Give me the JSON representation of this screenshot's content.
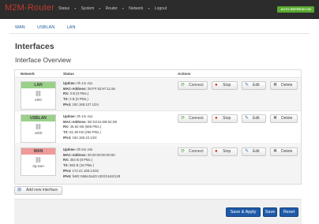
{
  "navbar": {
    "brand": "M2M-Router",
    "menu": [
      "Status",
      "System",
      "Router",
      "Network",
      "Logout"
    ],
    "auto_refresh": "AUTO REFRESH ON"
  },
  "subtabs": [
    "WAN",
    "USBLAN",
    "LAN"
  ],
  "page": {
    "title": "Interfaces",
    "subtitle": "Interface Overview"
  },
  "table": {
    "headers": {
      "network": "Network",
      "status": "Status",
      "actions": "Actions"
    },
    "rows": [
      {
        "name": "LAN",
        "color": "#9ad18a",
        "device": "eth0",
        "uptime_label": "Uptime:",
        "uptime": "0h 1m 41s",
        "mac_label": "MAC-Address:",
        "mac": "06:FF:63:97:11:66",
        "rx_label": "RX:",
        "rx": "0 B (0 Pkts.)",
        "tx_label": "TX:",
        "tx": "0 B (0 Pkts.)",
        "ipv4_label": "IPv4:",
        "ipv4": "192.168.127.1/24"
      },
      {
        "name": "USBLAN",
        "color": "#9ad18a",
        "device": "usb0",
        "uptime_label": "Uptime:",
        "uptime": "0h 1m 41s",
        "mac_label": "MAC-Address:",
        "mac": "5E:D2:51:B8:52:D5",
        "rx_label": "RX:",
        "rx": "45.84 KB (686 Pkts.)",
        "tx_label": "TX:",
        "tx": "81.38 KB (256 Pkts.)",
        "ipv4_label": "IPv4:",
        "ipv4": "192.168.10.1/24"
      },
      {
        "name": "WAN",
        "color": "#ef9a9a",
        "device": "3g-wan",
        "uptime_label": "Uptime:",
        "uptime": "0h 0m 44s",
        "mac_label": "MAC-Address:",
        "mac": "00:00:00:00:00:00",
        "rx_label": "RX:",
        "rx": "354 B (8 Pkts.)",
        "tx_label": "TX:",
        "tx": "862 B (16 Pkts.)",
        "ipv4_label": "IPv4:",
        "ipv4": "172.21.168.14/32",
        "ipv6_label": "IPv6:",
        "ipv6": "fe80::558a:5a23:c303:b163/128"
      }
    ],
    "actions": {
      "connect": "Connect",
      "stop": "Stop",
      "edit": "Edit",
      "delete": "Delete"
    }
  },
  "add_button": "Add new interface",
  "footer": {
    "save_apply": "Save & Apply",
    "save": "Save",
    "reset": "Reset"
  },
  "icons": {
    "connect": "refresh-icon",
    "stop": "stop-icon",
    "edit": "edit-icon",
    "delete": "delete-icon",
    "device": "network-port-icon",
    "add": "add-icon"
  },
  "colors": {
    "brand": "#c0392b",
    "primary": "#1e5aa8",
    "up": "#9ad18a",
    "down": "#ef9a9a",
    "auto_refresh": "#5aa832"
  }
}
